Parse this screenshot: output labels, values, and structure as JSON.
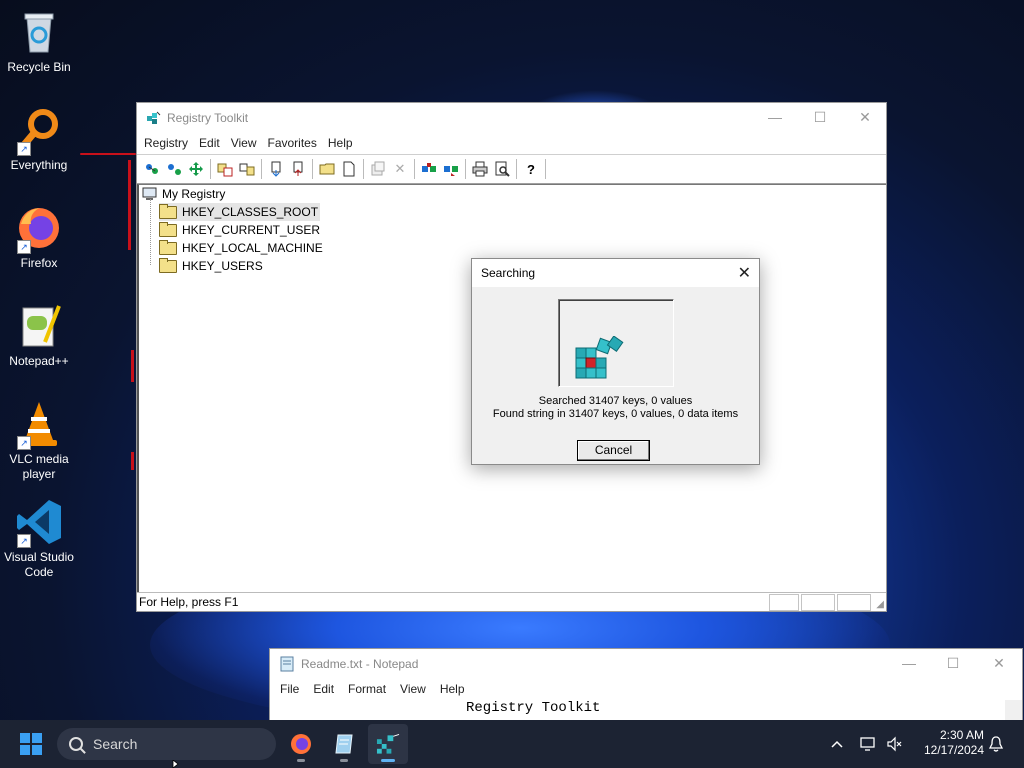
{
  "desktop": {
    "icons": [
      {
        "label": "Recycle Bin",
        "icon": "recycle-bin-icon"
      },
      {
        "label": "Everything",
        "icon": "everything-search-icon"
      },
      {
        "label": "Firefox",
        "icon": "firefox-icon"
      },
      {
        "label": "Notepad++",
        "icon": "notepad-plus-plus-icon"
      },
      {
        "label": "VLC media player",
        "icon": "vlc-icon"
      },
      {
        "label": "Visual Studio Code",
        "icon": "vscode-icon"
      }
    ]
  },
  "registry_window": {
    "title": "Registry Toolkit",
    "menu": [
      "Registry",
      "Edit",
      "View",
      "Favorites",
      "Help"
    ],
    "tree": {
      "root": "My Registry",
      "children": [
        "HKEY_CLASSES_ROOT",
        "HKEY_CURRENT_USER",
        "HKEY_LOCAL_MACHINE",
        "HKEY_USERS"
      ],
      "selected": "HKEY_CLASSES_ROOT"
    },
    "status": "For Help, press F1"
  },
  "search_dialog": {
    "title": "Searching",
    "line1": "Searched 31407 keys, 0 values",
    "line2": "Found string in 31407 keys, 0 values, 0 data items",
    "cancel_label": "Cancel"
  },
  "notepad": {
    "title": "Readme.txt - Notepad",
    "menu": [
      "File",
      "Edit",
      "Format",
      "View",
      "Help"
    ],
    "content": "Registry Toolkit"
  },
  "taskbar": {
    "search_placeholder": "Search",
    "time": "2:30 AM",
    "date": "12/17/2024"
  },
  "colors": {
    "accent": "#3aa0f3",
    "annotation": "#c8101a",
    "taskbar": "#1c2333"
  }
}
